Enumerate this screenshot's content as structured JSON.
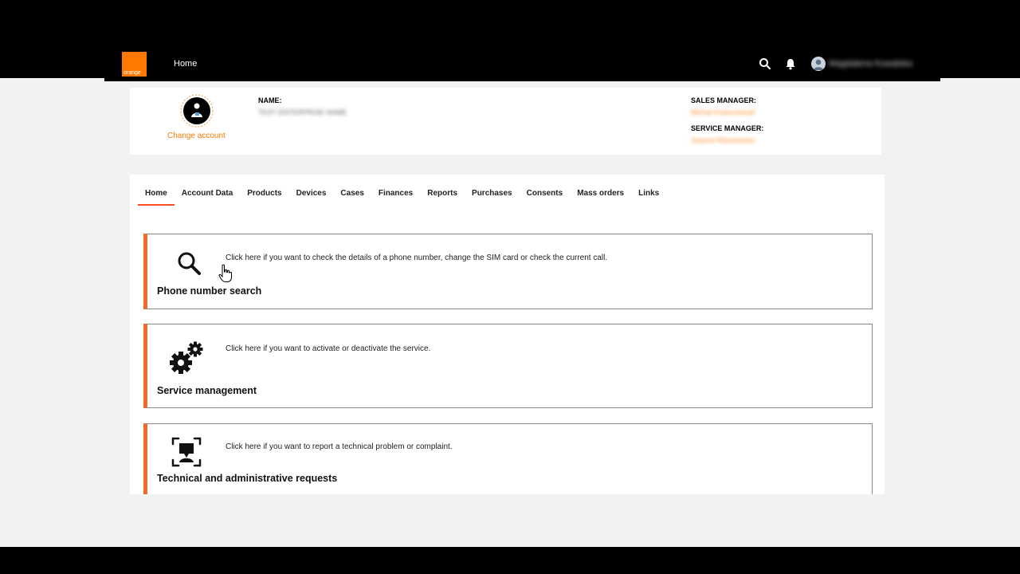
{
  "header": {
    "logo_text": "orange",
    "nav_home": "Home",
    "user_name": "Magdalena Kowalska"
  },
  "account": {
    "change_account": "Change account",
    "name_label": "NAME:",
    "name_value": "TEST ENTERPRISE NAME",
    "sales_manager_label": "SALES MANAGER:",
    "sales_manager_value": "Michal Krawczewski",
    "service_manager_label": "SERVICE MANAGER:",
    "service_manager_value": "Joanna Wisniewska"
  },
  "tabs": [
    {
      "label": "Home",
      "active": true
    },
    {
      "label": "Account Data"
    },
    {
      "label": "Products"
    },
    {
      "label": "Devices"
    },
    {
      "label": "Cases"
    },
    {
      "label": "Finances"
    },
    {
      "label": "Reports"
    },
    {
      "label": "Purchases"
    },
    {
      "label": "Consents"
    },
    {
      "label": "Mass orders"
    },
    {
      "label": "Links"
    }
  ],
  "tiles": [
    {
      "icon": "search-icon",
      "title": "Phone number search",
      "description": "Click here if you want to check the details of a phone number, change the SIM card or check the current call."
    },
    {
      "icon": "gears-icon",
      "title": "Service management",
      "description": "Click here if you want to activate or deactivate the service."
    },
    {
      "icon": "support-request-icon",
      "title": "Technical and administrative requests",
      "description": "Click here if you want to report a technical problem or complaint."
    }
  ],
  "colors": {
    "brand": "#ff7900",
    "accent": "#f06a29",
    "tab_underline": "#ff4f1f"
  }
}
